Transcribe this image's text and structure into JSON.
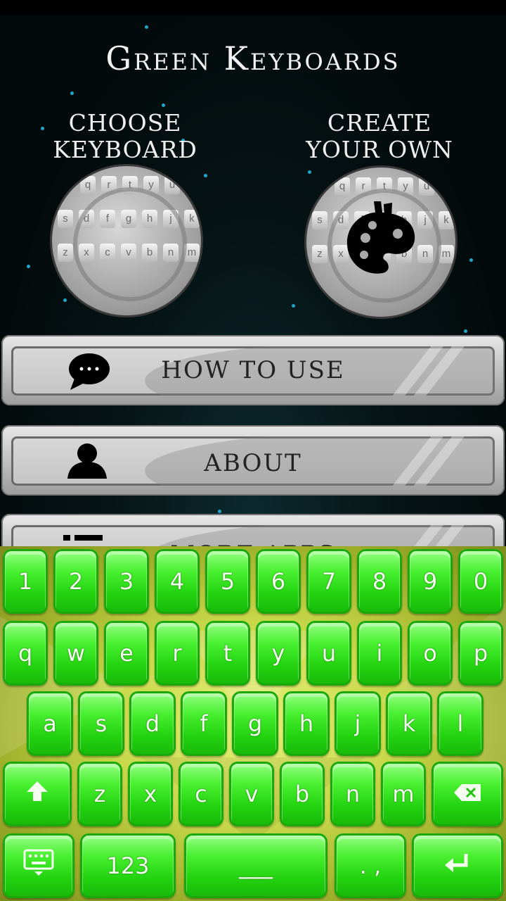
{
  "app": {
    "title": "Green Keyboards"
  },
  "tiles": {
    "choose": {
      "label_line1": "CHOOSE",
      "label_line2": "KEYBOARD"
    },
    "create": {
      "label_line1": "CREATE",
      "label_line2": "YOUR OWN"
    }
  },
  "mini_keyboard_rows": [
    [
      "q",
      "r",
      "t",
      "y",
      "u"
    ],
    [
      "s",
      "d",
      "f",
      "g",
      "h",
      "j",
      "k"
    ],
    [
      "z",
      "x",
      "c",
      "v",
      "b",
      "n",
      "m"
    ]
  ],
  "menu": [
    {
      "label": "HOW TO USE",
      "icon": "chat-bubble-icon"
    },
    {
      "label": "ABOUT",
      "icon": "person-icon"
    },
    {
      "label": "MORE APPS",
      "icon": "list-icon"
    }
  ],
  "keyboard": {
    "row_numbers": [
      "1",
      "2",
      "3",
      "4",
      "5",
      "6",
      "7",
      "8",
      "9",
      "0"
    ],
    "row_top": [
      "q",
      "w",
      "e",
      "r",
      "t",
      "y",
      "u",
      "i",
      "o",
      "p"
    ],
    "row_middle": [
      "a",
      "s",
      "d",
      "f",
      "g",
      "h",
      "j",
      "k",
      "l"
    ],
    "row_bottom": [
      "z",
      "x",
      "c",
      "v",
      "b",
      "n",
      "m"
    ],
    "shift_icon": "shift-arrow-icon",
    "backspace_icon": "backspace-icon",
    "keyboard_switch_icon": "keyboard-icon",
    "symbols_label": "123",
    "space_label": "___",
    "punct_label": ". ,",
    "enter_icon": "enter-icon"
  },
  "colors": {
    "key_green": "#22d20e",
    "background_yellow_green": "#c8d84a",
    "menu_gray": "#bdbdbd"
  }
}
